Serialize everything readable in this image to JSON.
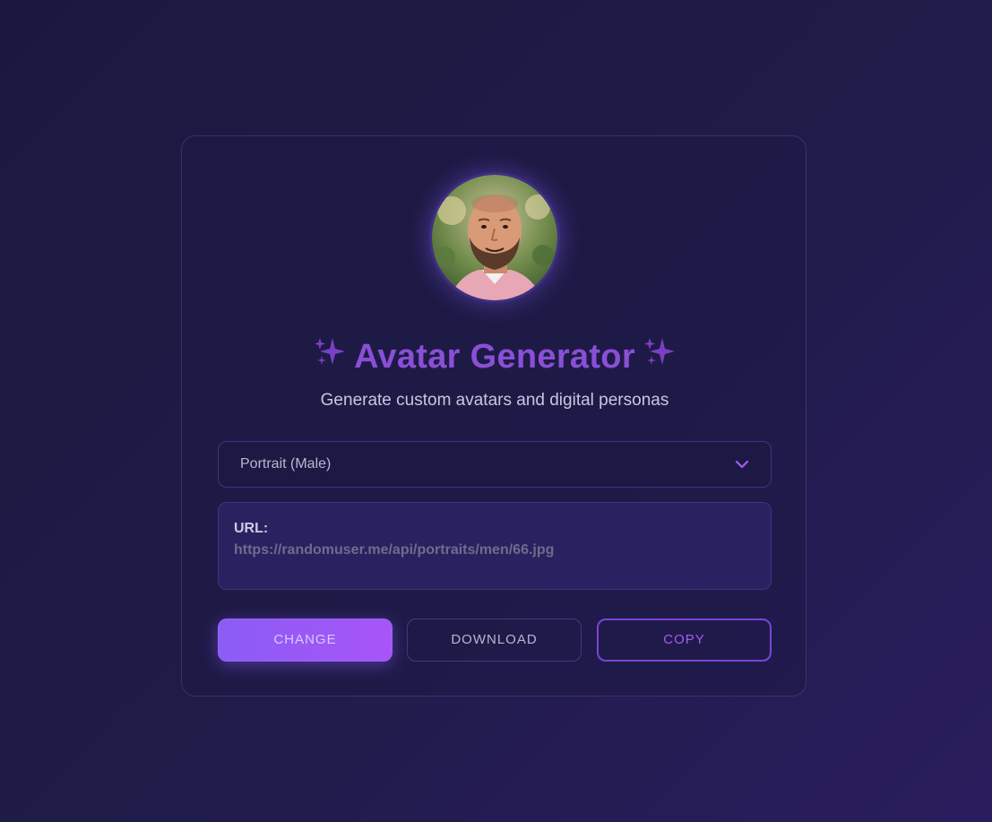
{
  "app": {
    "title": "Avatar Generator",
    "subtitle": "Generate custom avatars and digital personas",
    "title_spark_icon": "sparkles-icon"
  },
  "avatar": {
    "icon": "portrait-photo",
    "description_visible": false
  },
  "avatar_type_select": {
    "selected": "Portrait (Male)",
    "icon": "chevron-down-icon"
  },
  "url_box": {
    "label": "URL:",
    "value": "https://randomuser.me/api/portraits/men/66.jpg"
  },
  "buttons": {
    "change": "CHANGE",
    "download": "DOWNLOAD",
    "copy": "COPY"
  },
  "colors": {
    "accent": "#8b5cf6",
    "accent_alt": "#a855f7",
    "title": "#8a4fd6",
    "background": "#1f1c48"
  }
}
